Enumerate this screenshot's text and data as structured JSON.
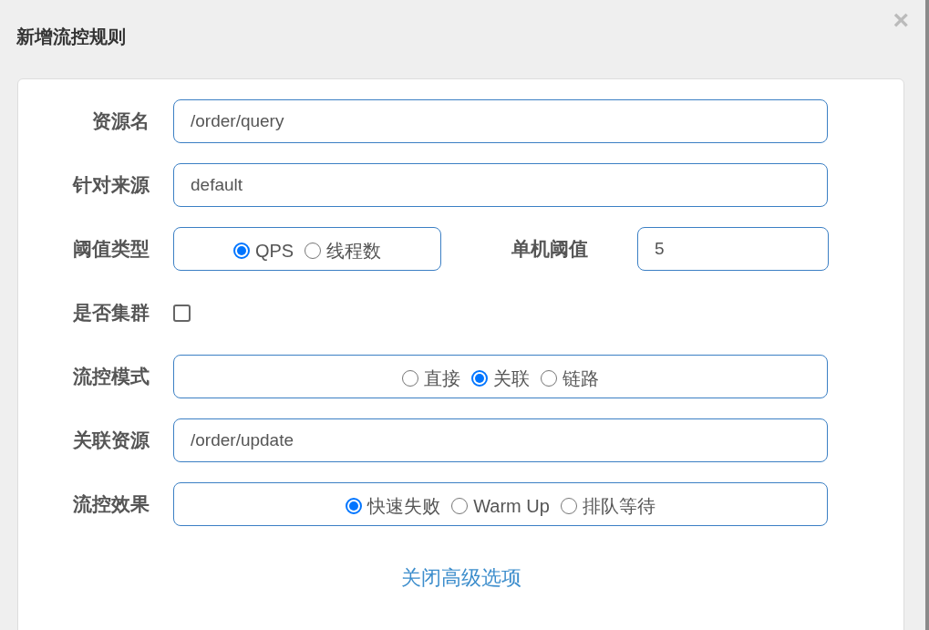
{
  "dialog": {
    "title": "新增流控规则",
    "close": "×"
  },
  "rows": [
    {
      "kind": "input",
      "label": "资源名",
      "value": "/order/query"
    },
    {
      "kind": "input",
      "label": "针对来源",
      "value": "default"
    },
    {
      "kind": "radio",
      "label": "阈值类型",
      "options": [
        {
          "label": "QPS",
          "selected": true
        },
        {
          "label": "线程数",
          "selected": false
        }
      ],
      "side": {
        "label": "单机阈值",
        "value": "5"
      }
    },
    {
      "kind": "checkbox",
      "label": "是否集群",
      "checked": false
    },
    {
      "kind": "radio",
      "label": "流控模式",
      "options": [
        {
          "label": "直接",
          "selected": false
        },
        {
          "label": "关联",
          "selected": true
        },
        {
          "label": "链路",
          "selected": false
        }
      ]
    },
    {
      "kind": "input",
      "label": "关联资源",
      "value": "/order/update"
    },
    {
      "kind": "radio",
      "label": "流控效果",
      "options": [
        {
          "label": "快速失败",
          "selected": true
        },
        {
          "label": "Warm Up",
          "selected": false
        },
        {
          "label": "排队等待",
          "selected": false
        }
      ]
    }
  ],
  "advanced_link": "关闭高级选项"
}
